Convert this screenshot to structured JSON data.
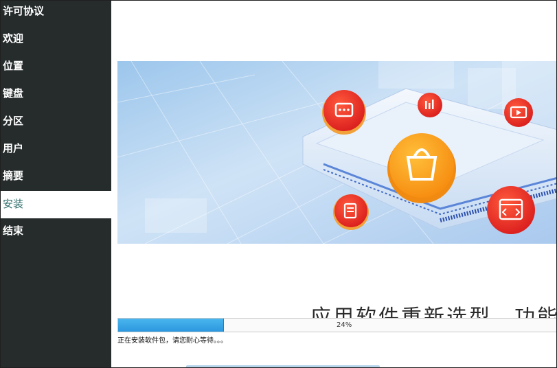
{
  "sidebar": {
    "items": [
      {
        "label": "许可协议",
        "active": false
      },
      {
        "label": "欢迎",
        "active": false
      },
      {
        "label": "位置",
        "active": false
      },
      {
        "label": "键盘",
        "active": false
      },
      {
        "label": "分区",
        "active": false
      },
      {
        "label": "用户",
        "active": false
      },
      {
        "label": "摘要",
        "active": false
      },
      {
        "label": "安装",
        "active": true
      },
      {
        "label": "结束",
        "active": false
      }
    ]
  },
  "banner": {
    "icons": [
      "chat-icon",
      "chart-icon",
      "shopping-bag-icon",
      "video-icon",
      "document-icon",
      "code-icon"
    ],
    "slogan": "应用软件重新选型，功能更全"
  },
  "progress": {
    "value": 0.24,
    "text": "24%",
    "status": "正在安装软件包，请您耐心等待。。。"
  },
  "colors": {
    "sidebar_bg": "#262c2c",
    "active_text": "#2e6d6a",
    "progress_fill": "#3aa8e8",
    "badge_red": "#e8322a",
    "badge_orange": "#ffa21a"
  }
}
